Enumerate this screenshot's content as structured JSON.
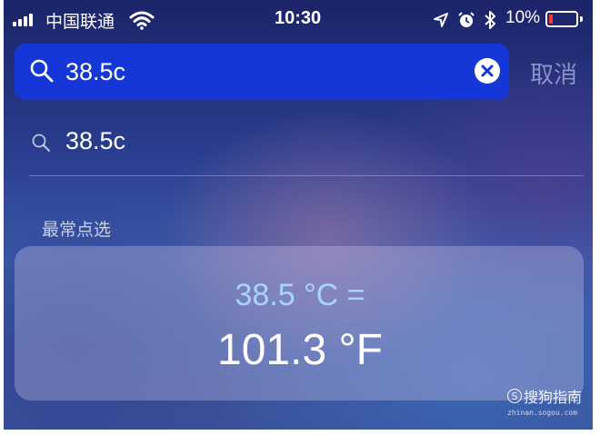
{
  "status_bar": {
    "carrier": "中国联通",
    "time": "10:30",
    "battery_percent": "10%",
    "battery_level": 0.1,
    "battery_color": "#ff3b30"
  },
  "search": {
    "query": "38.5c",
    "cancel_label": "取消"
  },
  "suggestion": {
    "text": "38.5c"
  },
  "section_title": "最常点选",
  "result": {
    "input_line": "38.5 °C =",
    "output_line": "101.3 °F"
  },
  "watermark": {
    "text": "搜狗指南",
    "url": "zhinan.sogou.com"
  },
  "colors": {
    "search_bar": "#1637d8",
    "result_input": "#a9d4ff",
    "cancel": "#8a92c8"
  }
}
